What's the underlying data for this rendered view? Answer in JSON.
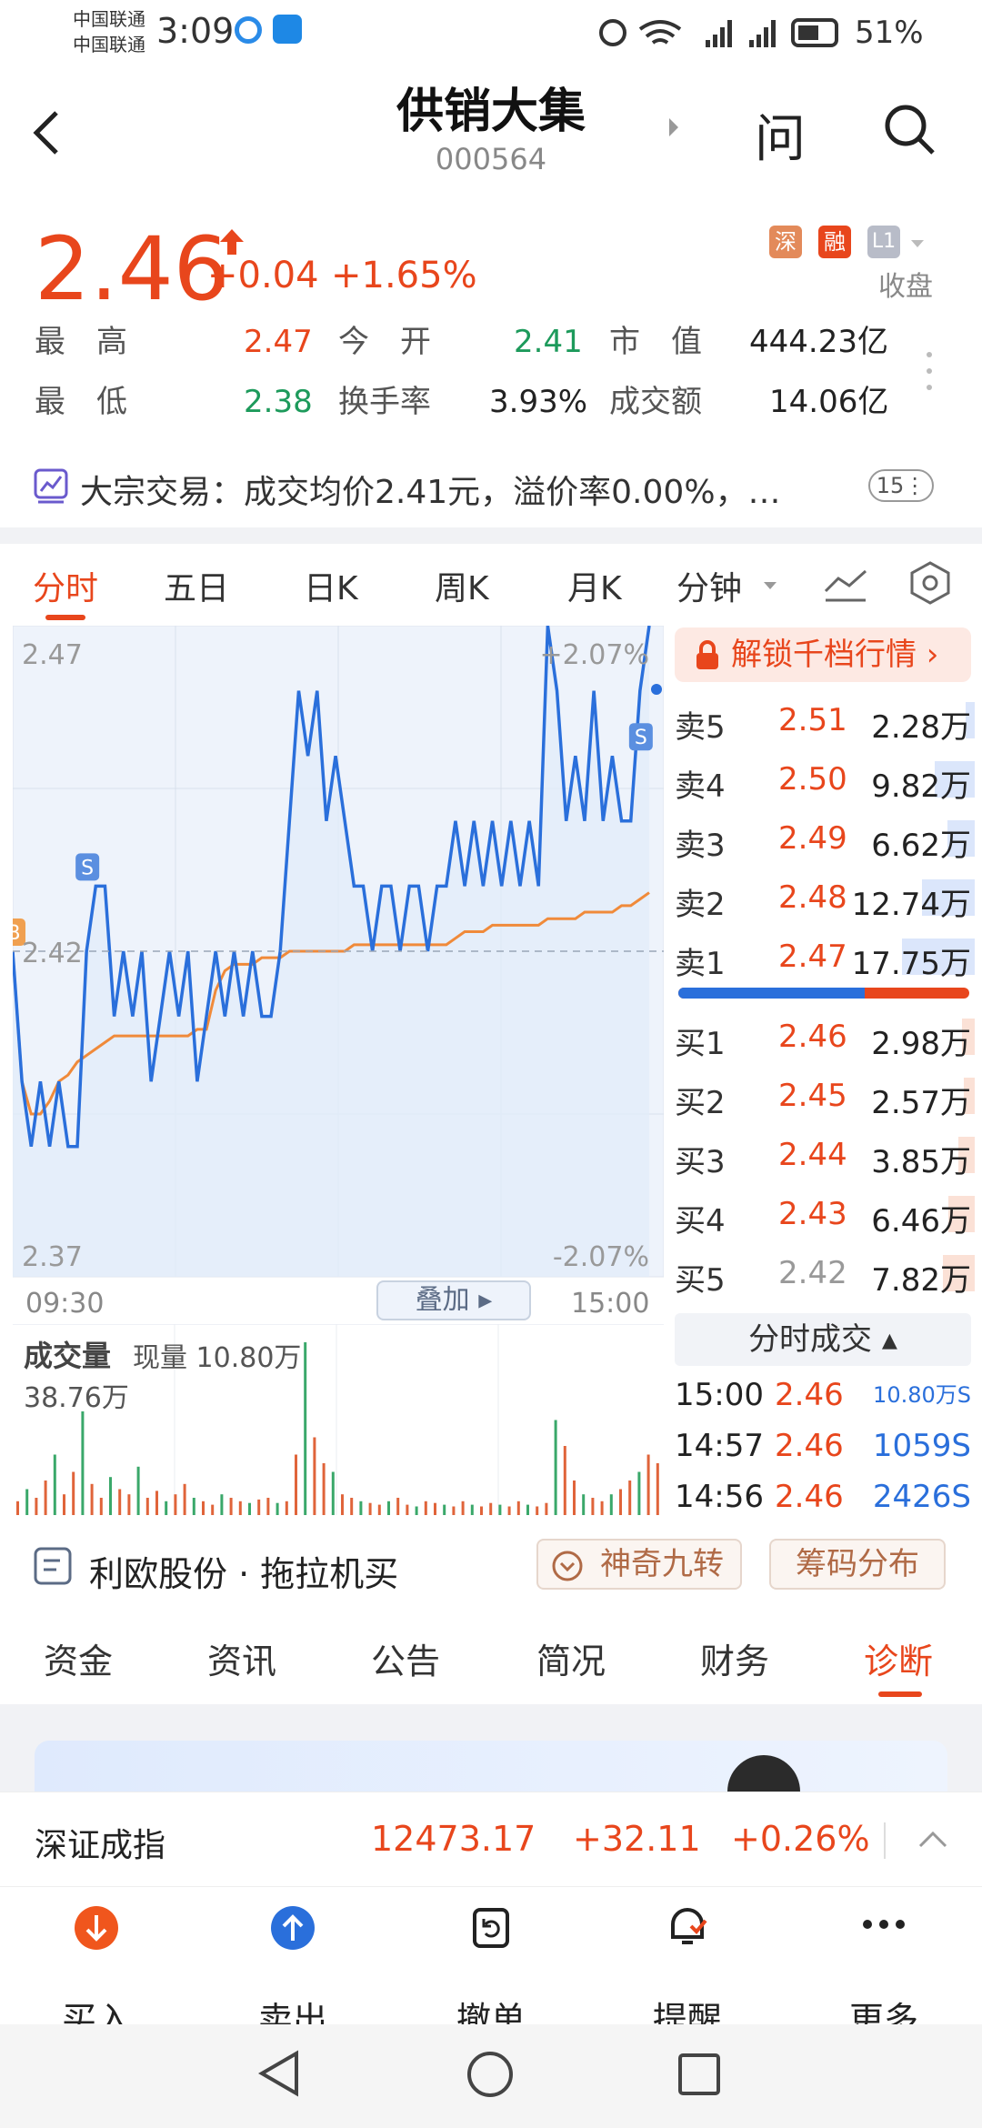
{
  "status": {
    "carrier1": "中国联通",
    "carrier2": "中国联通",
    "time": "3:09",
    "battery": "51%"
  },
  "header": {
    "name": "供销大集",
    "code": "000564",
    "ask_label": "问"
  },
  "quote": {
    "price": "2.46",
    "change": "+0.04",
    "change_pct": "+1.65%",
    "tags": [
      "深",
      "融",
      "L1"
    ],
    "market_state": "收盘",
    "stats": [
      {
        "label": "最　高",
        "value": "2.47"
      },
      {
        "label": "今　开",
        "value": "2.41"
      },
      {
        "label": "市　值",
        "value": "444.23亿"
      },
      {
        "label": "最　低",
        "value": "2.38"
      },
      {
        "label": "换手率",
        "value": "3.93%"
      },
      {
        "label": "成交额",
        "value": "14.06亿"
      }
    ]
  },
  "block_trade": {
    "text": "大宗交易：成交均价2.41元，溢价率0.00%，…",
    "count": "15"
  },
  "chart_tabs": [
    "分时",
    "五日",
    "日K",
    "周K",
    "月K",
    "分钟"
  ],
  "chart_data": {
    "type": "line",
    "y_ticks": [
      "2.47",
      "2.42",
      "2.37"
    ],
    "pct_ticks": [
      "+2.07%",
      "-2.07%"
    ],
    "x_ticks": [
      "09:30",
      "15:00"
    ],
    "overlay_label": "叠加",
    "ylim": [
      2.37,
      2.47
    ],
    "series": [
      {
        "color": "#2a6fdb",
        "values": [
          2.42,
          2.4,
          2.39,
          2.4,
          2.39,
          2.4,
          2.39,
          2.39,
          2.42,
          2.43,
          2.43,
          2.41,
          2.42,
          2.41,
          2.42,
          2.4,
          2.41,
          2.42,
          2.41,
          2.42,
          2.4,
          2.41,
          2.42,
          2.41,
          2.42,
          2.41,
          2.42,
          2.41,
          2.41,
          2.42,
          2.44,
          2.46,
          2.45,
          2.46,
          2.44,
          2.45,
          2.44,
          2.43,
          2.43,
          2.42,
          2.43,
          2.43,
          2.42,
          2.43,
          2.43,
          2.42,
          2.43,
          2.43,
          2.44,
          2.43,
          2.44,
          2.43,
          2.44,
          2.43,
          2.44,
          2.43,
          2.44,
          2.43,
          2.47,
          2.46,
          2.44,
          2.45,
          2.44,
          2.46,
          2.44,
          2.45,
          2.44,
          2.44,
          2.46,
          2.47
        ]
      },
      {
        "color": "#f08a3a",
        "values": [
          2.42,
          2.4,
          2.395,
          2.395,
          2.397,
          2.4,
          2.401,
          2.403,
          2.404,
          2.405,
          2.406,
          2.407,
          2.407,
          2.407,
          2.407,
          2.407,
          2.407,
          2.407,
          2.407,
          2.407,
          2.408,
          2.408,
          2.414,
          2.417,
          2.418,
          2.418,
          2.418,
          2.419,
          2.419,
          2.419,
          2.42,
          2.42,
          2.42,
          2.42,
          2.42,
          2.42,
          2.42,
          2.421,
          2.421,
          2.421,
          2.421,
          2.421,
          2.421,
          2.421,
          2.421,
          2.421,
          2.421,
          2.421,
          2.422,
          2.423,
          2.423,
          2.423,
          2.424,
          2.424,
          2.424,
          2.424,
          2.424,
          2.424,
          2.425,
          2.425,
          2.425,
          2.425,
          2.426,
          2.426,
          2.426,
          2.426,
          2.427,
          2.427,
          2.428,
          2.429
        ]
      }
    ],
    "markers": [
      "B",
      "S",
      "B",
      "S"
    ]
  },
  "volume": {
    "title": "成交量",
    "now_label": "现量 10.80万",
    "max_label": "38.76万"
  },
  "orderbook": {
    "unlock_label": "解锁千档行情",
    "asks": [
      {
        "label": "卖5",
        "price": "2.51",
        "vol": "2.28万",
        "fill": 0.13
      },
      {
        "label": "卖4",
        "price": "2.50",
        "vol": "9.82万",
        "fill": 0.55
      },
      {
        "label": "卖3",
        "price": "2.49",
        "vol": "6.62万",
        "fill": 0.37
      },
      {
        "label": "卖2",
        "price": "2.48",
        "vol": "12.74万",
        "fill": 0.72
      },
      {
        "label": "卖1",
        "price": "2.47",
        "vol": "17.75万",
        "fill": 1.0
      }
    ],
    "bids": [
      {
        "label": "买1",
        "price": "2.46",
        "vol": "2.98万",
        "fill": 0.17
      },
      {
        "label": "买2",
        "price": "2.45",
        "vol": "2.57万",
        "fill": 0.15
      },
      {
        "label": "买3",
        "price": "2.44",
        "vol": "3.85万",
        "fill": 0.22
      },
      {
        "label": "买4",
        "price": "2.43",
        "vol": "6.46万",
        "fill": 0.36
      },
      {
        "label": "买5",
        "price": "2.42",
        "vol": "7.82万",
        "fill": 0.44
      }
    ],
    "buy_ratio": 0.64
  },
  "ticks": {
    "title": "分时成交",
    "rows": [
      {
        "time": "15:00",
        "price": "2.46",
        "vol": "10.80万S"
      },
      {
        "time": "14:57",
        "price": "2.46",
        "vol": "1059S"
      },
      {
        "time": "14:56",
        "price": "2.46",
        "vol": "2426S"
      }
    ]
  },
  "news": {
    "text": "利欧股份 · 拖拉机买",
    "btn1": "神奇九转",
    "btn2": "筹码分布"
  },
  "sub_tabs": [
    "资金",
    "资讯",
    "公告",
    "简况",
    "财务",
    "诊断"
  ],
  "index": {
    "name": "深证成指",
    "value": "12473.17",
    "change": "+32.11",
    "pct": "+0.26%"
  },
  "actions": [
    "买入",
    "卖出",
    "撤单",
    "提醒",
    "更多"
  ]
}
